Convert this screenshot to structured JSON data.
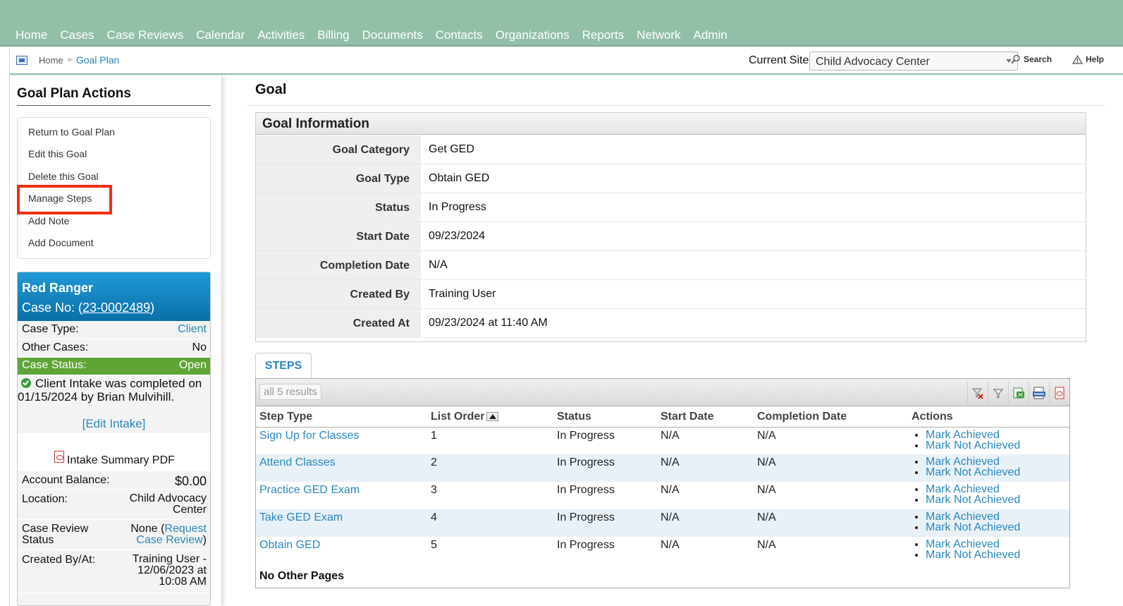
{
  "nav": {
    "items": [
      "Home",
      "Cases",
      "Case Reviews",
      "Calendar",
      "Activities",
      "Billing",
      "Documents",
      "Contacts",
      "Organizations",
      "Reports",
      "Network",
      "Admin"
    ]
  },
  "breadcrumb": {
    "home": "Home",
    "sep": "»",
    "current": "Goal Plan"
  },
  "site": {
    "label": "Current Site",
    "selected": "Child Advocacy Center"
  },
  "tools": {
    "search": "Search",
    "help": "Help"
  },
  "sidebar": {
    "title": "Goal Plan Actions",
    "actions": [
      "Return to Goal Plan",
      "Edit this Goal",
      "Delete this Goal",
      "Manage Steps",
      "Add Note",
      "Add Document"
    ]
  },
  "case": {
    "name": "Red Ranger",
    "case_no_label": "Case No: (",
    "case_no": "23-0002489",
    "case_no_close": ")",
    "type_label": "Case Type:",
    "type_value": "Client",
    "other_label": "Other Cases:",
    "other_value": "No",
    "status_label": "Case Status:",
    "status_value": "Open",
    "intake_msg": "Client Intake was completed on 01/15/2024 by Brian Mulvihill.",
    "edit_intake": "[Edit Intake]",
    "pdf_label": "Intake Summary PDF",
    "balance_label": "Account Balance:",
    "balance_value": "$0.00",
    "location_label": "Location:",
    "location_value": "Child Advocacy Center",
    "review_label": "Case Review Status",
    "review_none": "None (",
    "review_link": "Request Case Review",
    "review_close": ")",
    "created_label": "Created By/At:",
    "created_value": "Training User - 12/06/2023 at 10:08 AM"
  },
  "page": {
    "title": "Goal"
  },
  "goal_info": {
    "header": "Goal Information",
    "rows": [
      {
        "label": "Goal Category",
        "value": "Get GED"
      },
      {
        "label": "Goal Type",
        "value": "Obtain GED"
      },
      {
        "label": "Status",
        "value": "In Progress"
      },
      {
        "label": "Start Date",
        "value": "09/23/2024"
      },
      {
        "label": "Completion Date",
        "value": "N/A"
      },
      {
        "label": "Created By",
        "value": "Training User"
      },
      {
        "label": "Created At",
        "value": "09/23/2024 at 11:40 AM"
      }
    ]
  },
  "steps": {
    "tab": "STEPS",
    "results": "all 5 results",
    "columns": [
      "Step Type",
      "List Order",
      "Status",
      "Start Date",
      "Completion Date",
      "Actions"
    ],
    "rows": [
      {
        "type": "Sign Up for Classes",
        "order": "1",
        "status": "In Progress",
        "start": "N/A",
        "completion": "N/A"
      },
      {
        "type": "Attend Classes",
        "order": "2",
        "status": "In Progress",
        "start": "N/A",
        "completion": "N/A"
      },
      {
        "type": "Practice GED Exam",
        "order": "3",
        "status": "In Progress",
        "start": "N/A",
        "completion": "N/A"
      },
      {
        "type": "Take GED Exam",
        "order": "4",
        "status": "In Progress",
        "start": "N/A",
        "completion": "N/A"
      },
      {
        "type": "Obtain GED",
        "order": "5",
        "status": "In Progress",
        "start": "N/A",
        "completion": "N/A"
      }
    ],
    "action_achieved": "Mark Achieved",
    "action_not_achieved": "Mark Not Achieved",
    "footer": "No Other Pages",
    "toolbar_icons": [
      "clear-filter-icon",
      "filter-icon",
      "excel-export-icon",
      "csv-export-icon",
      "pdf-export-icon"
    ]
  },
  "colors": {
    "nav_bg": "#92bfa8",
    "link": "#2a87c0",
    "case_head": "#1f9ad6",
    "status_green": "#5fa535",
    "highlight": "#f0300a"
  }
}
